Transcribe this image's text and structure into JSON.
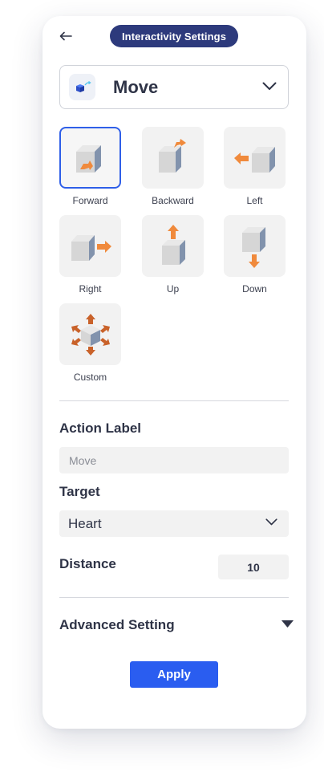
{
  "header": {
    "title": "Interactivity Settings"
  },
  "action_type": {
    "label": "Move",
    "icon": "cube-move-icon"
  },
  "directions": [
    {
      "label": "Forward",
      "icon": "move-forward-icon",
      "selected": true
    },
    {
      "label": "Backward",
      "icon": "move-backward-icon",
      "selected": false
    },
    {
      "label": "Left",
      "icon": "move-left-icon",
      "selected": false
    },
    {
      "label": "Right",
      "icon": "move-right-icon",
      "selected": false
    },
    {
      "label": "Up",
      "icon": "move-up-icon",
      "selected": false
    },
    {
      "label": "Down",
      "icon": "move-down-icon",
      "selected": false
    },
    {
      "label": "Custom",
      "icon": "move-custom-icon",
      "selected": false
    }
  ],
  "action_label": {
    "heading": "Action Label",
    "placeholder": "Move"
  },
  "target": {
    "heading": "Target",
    "value": "Heart"
  },
  "distance": {
    "heading": "Distance",
    "value": "10"
  },
  "advanced": {
    "heading": "Advanced Setting"
  },
  "apply_label": "Apply",
  "colors": {
    "accent": "#2a5df0",
    "title_pill": "#2d3a7c",
    "arrow": "#f08a3c",
    "cube_front": "#d4d4d4",
    "cube_side": "#7f8fa8"
  }
}
